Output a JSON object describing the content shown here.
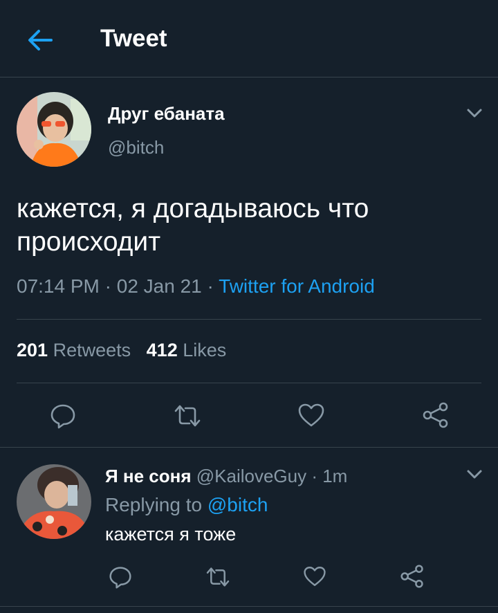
{
  "header": {
    "title": "Tweet"
  },
  "tweet": {
    "author_name": "Друг ебаната",
    "author_handle": "@bitch",
    "text": "кажется, я догадываюсь что происходит",
    "time": "07:14 PM",
    "date": "02 Jan 21",
    "source": "Twitter for Android",
    "retweets_count": "201",
    "retweets_label": "Retweets",
    "likes_count": "412",
    "likes_label": "Likes"
  },
  "reply": {
    "author_name": "Я не соня",
    "author_handle": "@KailoveGuy",
    "time": "1m",
    "replying_prefix": "Replying to",
    "replying_to": "@bitch",
    "text": "кажется я тоже"
  },
  "icons": [
    "back-arrow-icon",
    "chevron-down-icon",
    "reply-icon",
    "retweet-icon",
    "like-icon",
    "share-icon"
  ],
  "colors": {
    "background": "#15202b",
    "accent": "#1da1f2",
    "muted": "#8899a6",
    "divider": "#38444d"
  }
}
